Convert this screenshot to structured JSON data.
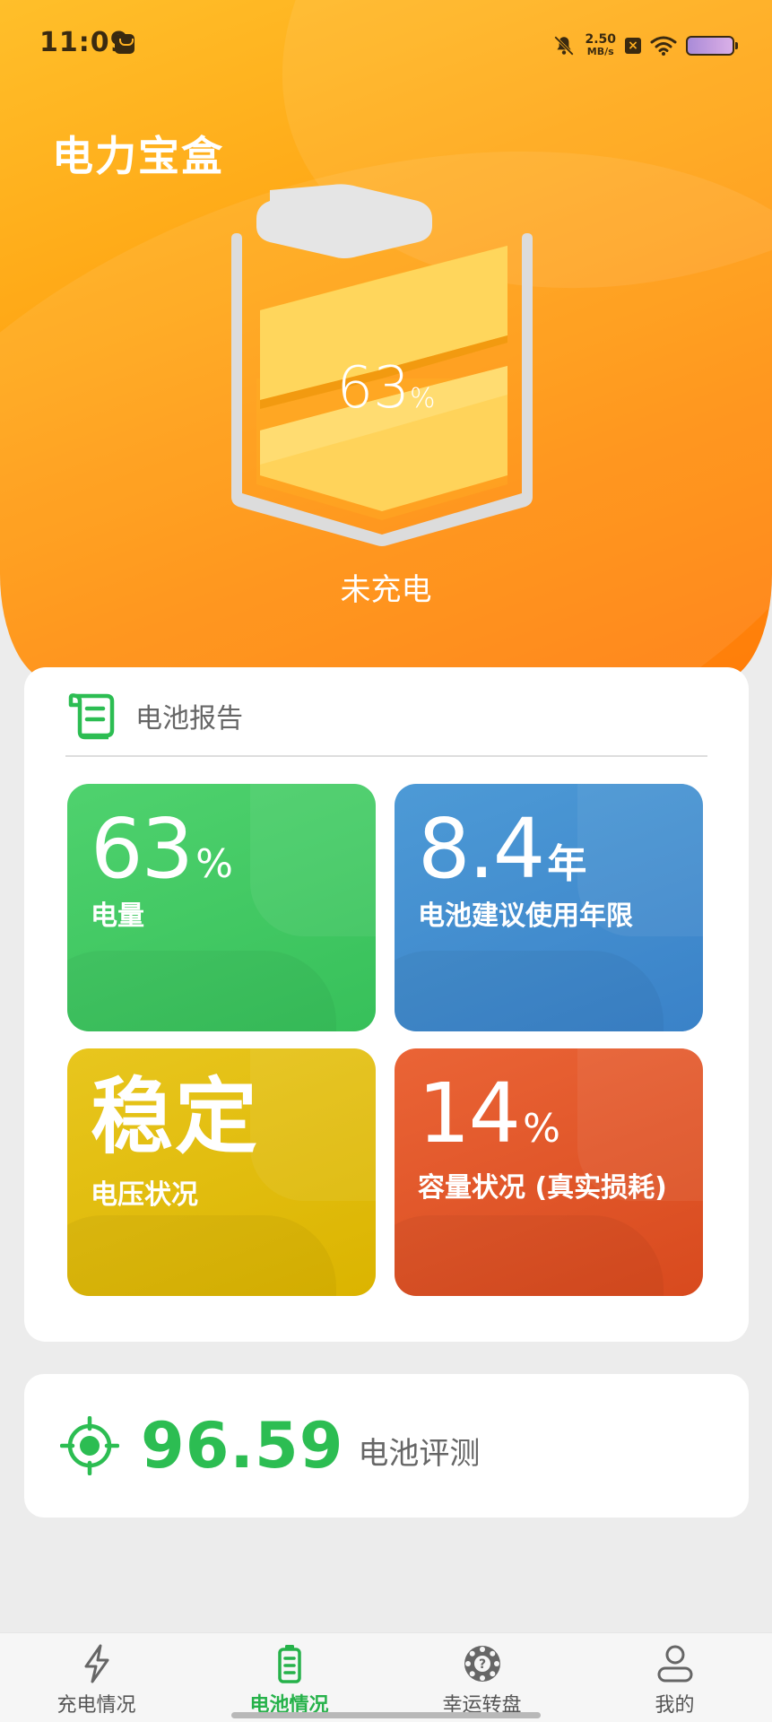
{
  "status_bar": {
    "time": "11:09",
    "net_speed_value": "2.50",
    "net_speed_unit": "MB/s",
    "icons": [
      "app-notification-icon",
      "bell-off-icon",
      "close-box-icon",
      "wifi-icon",
      "battery-icon"
    ]
  },
  "header": {
    "title": "电力宝盒",
    "battery_level": 63,
    "battery_percent_value": "63",
    "battery_percent_unit": "%",
    "charge_status": "未充电"
  },
  "report": {
    "title": "电池报告",
    "icon": "scroll-report-icon",
    "tiles": [
      {
        "value": "63",
        "unit": "%",
        "label": "电量",
        "color": "#3fc762"
      },
      {
        "value": "8.4",
        "unit": "年",
        "label": "电池建议使用年限",
        "color": "#4690d0"
      },
      {
        "value": "稳定",
        "unit": "",
        "label": "电压状况",
        "color": "#e1bd0f"
      },
      {
        "value": "14",
        "unit": "%",
        "label": "容量状况 (真实损耗)",
        "color": "#e05628"
      }
    ]
  },
  "score": {
    "icon": "target-icon",
    "value": "96.59",
    "label": "电池评测",
    "color": "#2cbd52"
  },
  "nav": {
    "items": [
      {
        "label": "充电情况",
        "icon": "lightning-icon",
        "active": false
      },
      {
        "label": "电池情况",
        "icon": "battery-icon",
        "active": true
      },
      {
        "label": "幸运转盘",
        "icon": "wheel-icon",
        "active": false
      },
      {
        "label": "我的",
        "icon": "person-icon",
        "active": false
      }
    ],
    "active_color": "#26b24a"
  },
  "colors": {
    "header_gradient_start": "#ffbf2a",
    "header_gradient_end": "#ff7d0a",
    "accent_green": "#2cbd52"
  }
}
